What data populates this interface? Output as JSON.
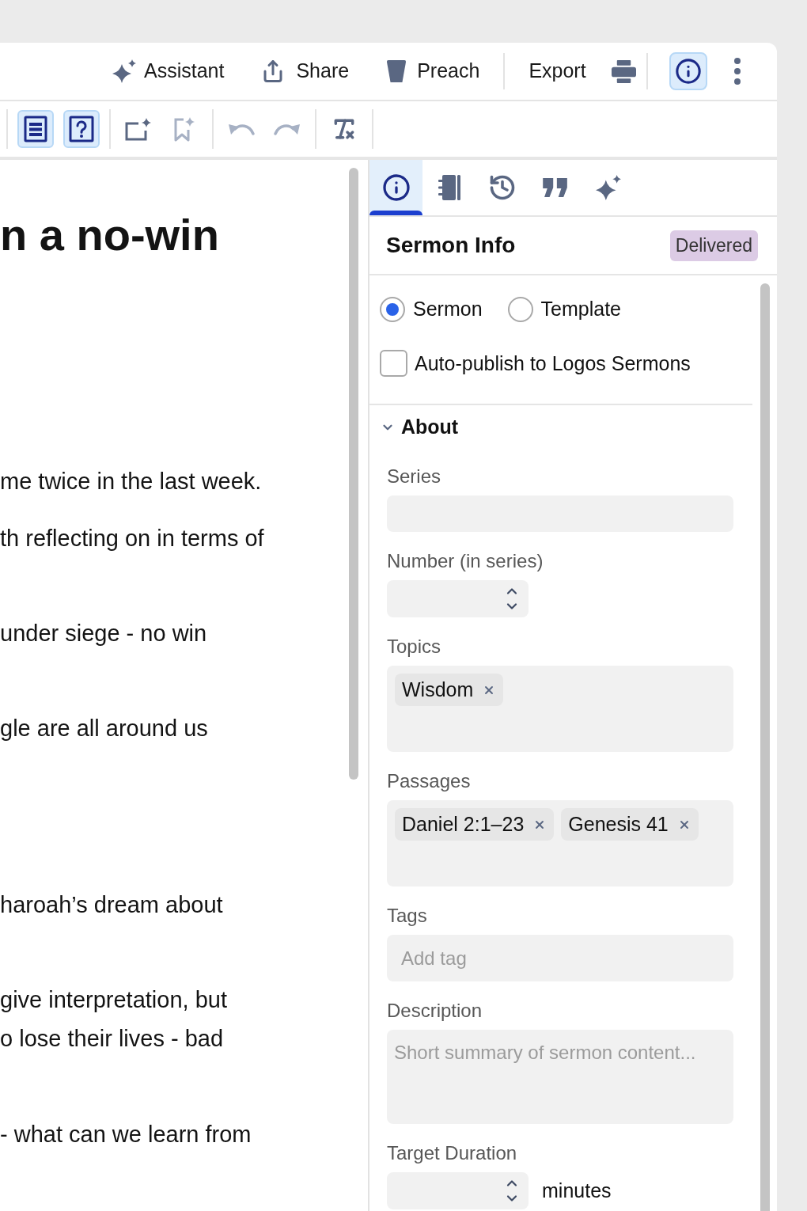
{
  "top_bar": {
    "actions": [
      {
        "label": "Assistant"
      },
      {
        "label": "Share"
      },
      {
        "label": "Preach"
      },
      {
        "label": "Export"
      }
    ],
    "info_button": {
      "selected": true
    }
  },
  "toolbar": {
    "buttons": [
      {
        "selected": true,
        "disabled": false
      },
      {
        "selected": true,
        "disabled": false
      },
      {
        "selected": false,
        "disabled": false
      },
      {
        "selected": false,
        "disabled": true
      },
      {
        "selected": false,
        "disabled": true
      },
      {
        "selected": false,
        "disabled": true
      },
      {
        "selected": false,
        "disabled": false
      }
    ]
  },
  "editor": {
    "heading": "n a no-win",
    "paragraphs": [
      {
        "lines": [
          "me twice in the last week."
        ]
      },
      {
        "lines": [
          "th reflecting on in terms of"
        ]
      },
      {
        "lines": [
          "under siege - no win"
        ]
      },
      {
        "lines": [
          "gle are all around us"
        ]
      },
      {
        "lines": [
          "haroah’s dream about"
        ]
      },
      {
        "lines": [
          "give interpretation, but",
          "o lose their lives - bad"
        ]
      },
      {
        "lines": [
          "- what can we learn from"
        ]
      }
    ]
  },
  "panel": {
    "tabs": [
      {
        "selected": true
      },
      {
        "selected": false
      },
      {
        "selected": false
      },
      {
        "selected": false
      },
      {
        "selected": false
      }
    ],
    "title": "Sermon Info",
    "status_badge": "Delivered",
    "type_options": [
      {
        "label": "Sermon",
        "selected": true
      },
      {
        "label": "Template",
        "selected": false
      }
    ],
    "auto_publish": {
      "label": "Auto-publish to Logos Sermons",
      "checked": false
    },
    "section": {
      "title": "About",
      "expanded": true,
      "fields": [
        {
          "kind": "text",
          "label": "Series"
        },
        {
          "kind": "number",
          "label": "Number (in series)"
        },
        {
          "kind": "chips",
          "label": "Topics",
          "chips": [
            "Wisdom"
          ]
        },
        {
          "kind": "chips",
          "label": "Passages",
          "chips": [
            "Daniel 2:1–23",
            "Genesis 41"
          ]
        },
        {
          "kind": "tag_input",
          "label": "Tags",
          "placeholder": "Add tag"
        },
        {
          "kind": "textarea",
          "label": "Description",
          "placeholder": "Short summary of sermon content..."
        },
        {
          "kind": "number",
          "label": "Target Duration",
          "suffix": "minutes"
        }
      ]
    }
  }
}
